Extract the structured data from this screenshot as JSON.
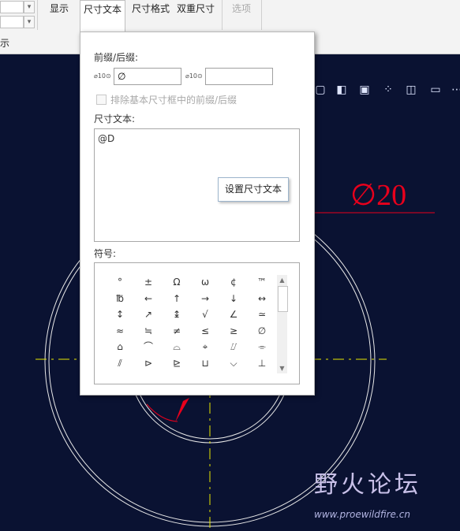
{
  "ribbon": {
    "tabs": [
      {
        "label": "显示"
      },
      {
        "label": "尺寸文本"
      },
      {
        "label": "尺寸格式"
      },
      {
        "label": "双重尺寸"
      },
      {
        "label": "选项"
      }
    ]
  },
  "subbar": {
    "label": "示"
  },
  "panel": {
    "prefix_suffix_label": "前缀/后缀:",
    "prefix_icon_text": "⌀10⊙",
    "prefix_value": "∅",
    "suffix_icon_text": "⌀10⊙",
    "suffix_value": "",
    "exclude_label": "排除基本尺寸框中的前缀/后缀",
    "dim_text_label": "尺寸文本:",
    "dim_text_value": "@D",
    "tooltip": "设置尺寸文本",
    "symbols_label": "符号:",
    "symbols": [
      "°",
      "±",
      "Ω",
      "ω",
      "¢",
      "™",
      "℔",
      "←",
      "↑",
      "→",
      "↓",
      "↔",
      "↕",
      "↗",
      "↨",
      "√",
      "∠",
      "≃",
      "≈",
      "≒",
      "≠",
      "≤",
      "≥",
      "∅",
      "⌂",
      "⌒",
      "⌓",
      "⌖",
      "⌰",
      "⌯",
      "⫽",
      "⊳",
      "⊵",
      "⊔",
      "⌵",
      "⊥"
    ]
  },
  "cad": {
    "dimension_text": "∅20",
    "toolbar_icons": [
      "cube-icon",
      "box-icon",
      "box-plus-icon",
      "trim-icon",
      "eraser-icon",
      "flag-icon"
    ]
  },
  "watermark": {
    "title": "野火论坛",
    "url": "www.proewildfire.cn"
  },
  "colors": {
    "cad_bg": "#0a1232",
    "dimension": "#e8001c",
    "centerline": "#e8e800",
    "geometry": "#e8e8e8"
  }
}
